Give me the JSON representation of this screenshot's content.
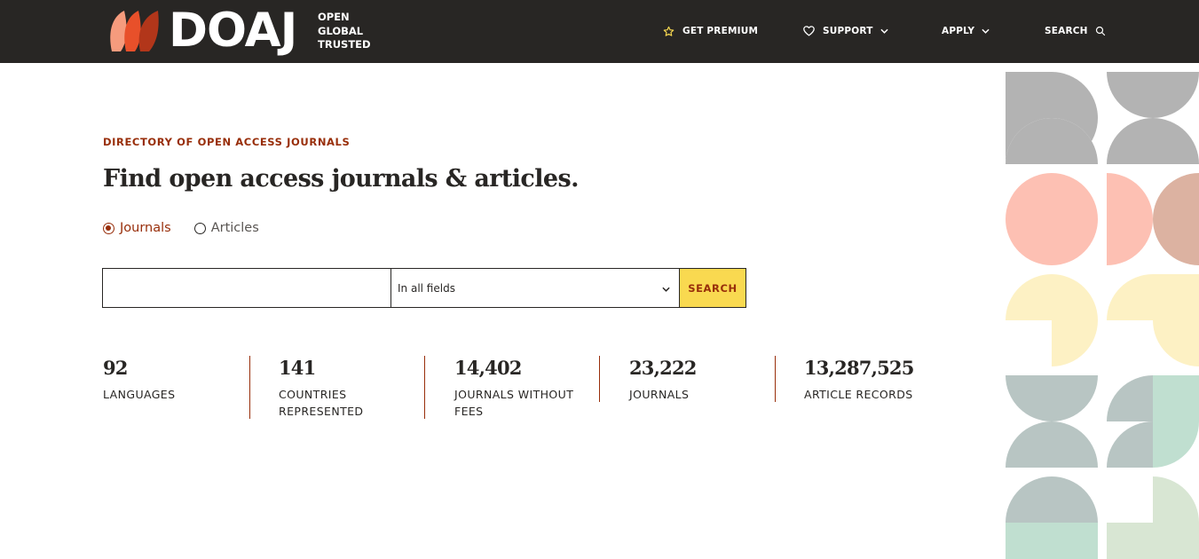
{
  "header": {
    "logo": {
      "wordmark": "DOAJ",
      "tagline": [
        "OPEN",
        "GLOBAL",
        "TRUSTED"
      ],
      "colors": [
        "#f59b7d",
        "#e8502a",
        "#b2361a"
      ]
    },
    "nav": [
      {
        "label": "GET PREMIUM",
        "icon": "star-icon",
        "icon_color": "#f9d950"
      },
      {
        "label": "SUPPORT",
        "icon": "heart-icon",
        "has_dropdown": true
      },
      {
        "label": "APPLY",
        "has_dropdown": true
      },
      {
        "label": "SEARCH",
        "icon": "search-icon"
      }
    ]
  },
  "hero": {
    "eyebrow": "DIRECTORY OF OPEN ACCESS JOURNALS",
    "headline": "Find open access journals & articles.",
    "search_type": {
      "options": [
        "Journals",
        "Articles"
      ],
      "selected": "Journals"
    },
    "search": {
      "input_value": "",
      "field_selected": "In all fields",
      "button_label": "SEARCH"
    }
  },
  "stats": [
    {
      "value": "92",
      "label": "LANGUAGES"
    },
    {
      "value": "141",
      "label": "COUNTRIES REPRESENTED"
    },
    {
      "value": "14,402",
      "label": "JOURNALS WITHOUT FEES"
    },
    {
      "value": "23,222",
      "label": "JOURNALS"
    },
    {
      "value": "13,287,525",
      "label": "ARTICLE RECORDS"
    }
  ],
  "colors": {
    "header_bg": "#282624",
    "accent_red": "#982e0a",
    "button_yellow": "#f9d950",
    "pattern_grey": "#b3b3b3",
    "pattern_pink": "#fdc0b3",
    "pattern_tan": "#dcb2a1",
    "pattern_yellow": "#fdf1c4",
    "pattern_slate": "#b8c5c3",
    "pattern_mint": "#c0dfd0",
    "pattern_sage": "#d8e6d3"
  }
}
